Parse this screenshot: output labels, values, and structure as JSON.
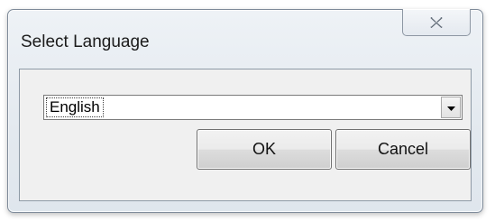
{
  "dialog": {
    "title": "Select Language",
    "close_glyph": "close-icon"
  },
  "language_select": {
    "selected": "English",
    "arrow_icon": "chevron-down-icon"
  },
  "buttons": {
    "ok_label": "OK",
    "cancel_label": "Cancel"
  }
}
